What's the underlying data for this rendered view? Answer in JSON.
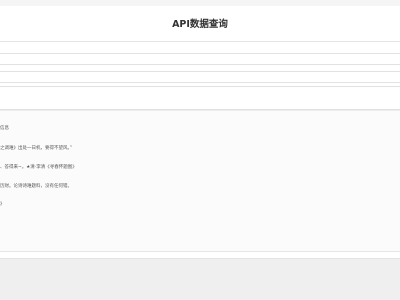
{
  "page": {
    "title": "API数据查询"
  },
  "result": {
    "lines": [
      "信息",
      "之调难》出处一日机，要得不望风。”",
      "、答得来~。★清·李清《寻春怀题图》",
      "历财。论诗诗难题料，没有任何错。",
      "》"
    ]
  }
}
